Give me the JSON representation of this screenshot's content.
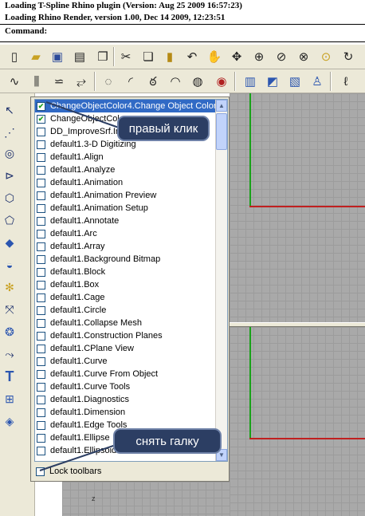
{
  "command_history": {
    "line1": "Loading T-Spline Rhino plugin (Version: Aug 25 2009  16:57:23)",
    "line2": "Loading Rhino Render, version 1.00, Dec 14 2009, 12:23:51",
    "prompt": "Command:"
  },
  "toolbar_list": {
    "items": [
      {
        "label": "ChangeObjectColor4.Change Object Color",
        "checked": true,
        "selected": true
      },
      {
        "label": "ChangeObjectColor",
        "checked": true,
        "selected": false
      },
      {
        "label": "DD_ImproveSrf.Im",
        "checked": false,
        "selected": false
      },
      {
        "label": "default1.3-D Digitizing",
        "checked": false,
        "selected": false
      },
      {
        "label": "default1.Align",
        "checked": false,
        "selected": false
      },
      {
        "label": "default1.Analyze",
        "checked": false,
        "selected": false
      },
      {
        "label": "default1.Animation",
        "checked": false,
        "selected": false
      },
      {
        "label": "default1.Animation Preview",
        "checked": false,
        "selected": false
      },
      {
        "label": "default1.Animation Setup",
        "checked": false,
        "selected": false
      },
      {
        "label": "default1.Annotate",
        "checked": false,
        "selected": false
      },
      {
        "label": "default1.Arc",
        "checked": false,
        "selected": false
      },
      {
        "label": "default1.Array",
        "checked": false,
        "selected": false
      },
      {
        "label": "default1.Background Bitmap",
        "checked": false,
        "selected": false
      },
      {
        "label": "default1.Block",
        "checked": false,
        "selected": false
      },
      {
        "label": "default1.Box",
        "checked": false,
        "selected": false
      },
      {
        "label": "default1.Cage",
        "checked": false,
        "selected": false
      },
      {
        "label": "default1.Circle",
        "checked": false,
        "selected": false
      },
      {
        "label": "default1.Collapse Mesh",
        "checked": false,
        "selected": false
      },
      {
        "label": "default1.Construction Planes",
        "checked": false,
        "selected": false
      },
      {
        "label": "default1.CPlane View",
        "checked": false,
        "selected": false
      },
      {
        "label": "default1.Curve",
        "checked": false,
        "selected": false
      },
      {
        "label": "default1.Curve From Object",
        "checked": false,
        "selected": false
      },
      {
        "label": "default1.Curve Tools",
        "checked": false,
        "selected": false
      },
      {
        "label": "default1.Diagnostics",
        "checked": false,
        "selected": false
      },
      {
        "label": "default1.Dimension",
        "checked": false,
        "selected": false
      },
      {
        "label": "default1.Edge Tools",
        "checked": false,
        "selected": false
      },
      {
        "label": "default1.Ellipse",
        "checked": false,
        "selected": false
      },
      {
        "label": "default1.Ellipsoid",
        "checked": false,
        "selected": false
      }
    ],
    "lock_toolbars": {
      "label": "Lock toolbars",
      "checked": false
    }
  },
  "callouts": {
    "right_click": "правый клик",
    "uncheck": "снять галку"
  },
  "viewport": {
    "axis_label": "z"
  },
  "icons": {
    "toolbar1": [
      "new-file-icon",
      "open-folder-icon",
      "save-icon",
      "print-icon",
      "import-icon",
      "cut-icon",
      "copy-icon",
      "paste-icon",
      "undo-icon",
      "pan-hand-icon",
      "rotate-view-icon",
      "zoom-window-icon",
      "zoom-dynamic-icon",
      "zoom-extents-icon",
      "zoom-selected-icon",
      "rotate-icon"
    ],
    "toolbar2": [
      "curve-icon",
      "control-points-icon",
      "polyline-icon",
      "rebuild-icon",
      "circle-icon",
      "arc-icon",
      "lasso-icon",
      "edit-pt-icon",
      "color-icon",
      "layer-icon",
      "properties-icon",
      "render-icon",
      "user-icon",
      "lasso-select-icon"
    ],
    "left": [
      "select-arrow-icon",
      "point-icon",
      "circle-tool-icon",
      "curve-tool-icon",
      "polygon-icon",
      "control-point-icon",
      "box-solid-icon",
      "cylinder-icon",
      "fillet-icon",
      "transform-icon",
      "boolean-icon",
      "sweep-icon",
      "text-tool-icon",
      "group-icon",
      "render-cube-icon"
    ]
  }
}
